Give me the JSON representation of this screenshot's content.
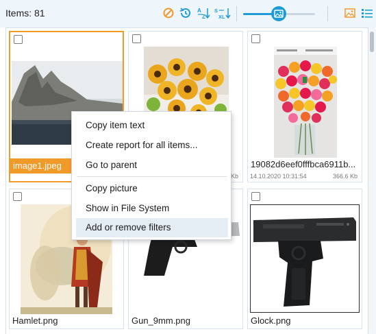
{
  "toolbar": {
    "items_count": "Items: 81",
    "icons": [
      "no-filter-icon",
      "history-icon",
      "sort-alpha-icon",
      "sort-size-icon",
      "thumbnail-size-slider",
      "image-view-icon",
      "details-view-icon"
    ],
    "thumbnail_size_fraction": 0.5,
    "accent_color": "#1e9bd7",
    "warning_color": "#f19a2a"
  },
  "grid": {
    "items": [
      {
        "name": "image1.jpeg",
        "selected": true
      },
      {
        "name": "",
        "date": "",
        "size": "Kb"
      },
      {
        "name": "19082d6eef0fffbca6911b...",
        "date": "14.10.2020 10:31:54",
        "size": "366.6 Kb"
      },
      {
        "name": "Hamlet.png"
      },
      {
        "name": "Gun_9mm.png"
      },
      {
        "name": "Glock.png"
      }
    ]
  },
  "context_menu": {
    "items": [
      {
        "label": "Copy item text"
      },
      {
        "label": "Create report for all items..."
      },
      {
        "label": "Go to parent"
      },
      {
        "label": "Copy picture"
      },
      {
        "label": "Show in File System"
      },
      {
        "label": "Add or remove filters",
        "hovered": true
      }
    ]
  }
}
